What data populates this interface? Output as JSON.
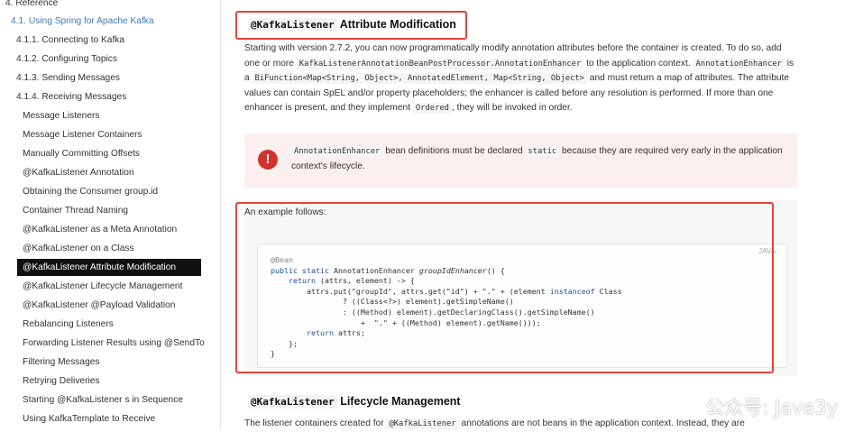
{
  "sidebar": {
    "items": [
      {
        "label": "4. Reference",
        "level": 0
      },
      {
        "label": "4.1. Using Spring for Apache Kafka",
        "level": 1
      },
      {
        "label": "4.1.1. Connecting to Kafka",
        "level": 2
      },
      {
        "label": "4.1.2. Configuring Topics",
        "level": 2
      },
      {
        "label": "4.1.3. Sending Messages",
        "level": 2
      },
      {
        "label": "4.1.4. Receiving Messages",
        "level": 2
      },
      {
        "label": "Message Listeners",
        "level": 3
      },
      {
        "label": "Message Listener Containers",
        "level": 3
      },
      {
        "label": "Manually Committing Offsets",
        "level": 3
      },
      {
        "label": "@KafkaListener Annotation",
        "level": 3
      },
      {
        "label": "Obtaining the Consumer group.id",
        "level": 3
      },
      {
        "label": "Container Thread Naming",
        "level": 3
      },
      {
        "label": "@KafkaListener as a Meta Annotation",
        "level": 3
      },
      {
        "label": "@KafkaListener on a Class",
        "level": 3
      },
      {
        "label": "@KafkaListener Attribute Modification",
        "level": 3,
        "active": true
      },
      {
        "label": "@KafkaListener Lifecycle Management",
        "level": 3
      },
      {
        "label": "@KafkaListener @Payload Validation",
        "level": 3
      },
      {
        "label": "Rebalancing Listeners",
        "level": 3
      },
      {
        "label": "Forwarding Listener Results using @SendTo",
        "level": 3
      },
      {
        "label": "Filtering Messages",
        "level": 3
      },
      {
        "label": "Retrying Deliveries",
        "level": 3
      },
      {
        "label": "Starting @KafkaListener s in Sequence",
        "level": 3
      },
      {
        "label": "Using KafkaTemplate to Receive",
        "level": 3
      }
    ]
  },
  "section1": {
    "title_code": "@KafkaListener",
    "title_text": "Attribute Modification",
    "p1_a": "Starting with version 2.7.2, you can now programmatically modify annotation attributes before the container is created. To do so, add one or more",
    "p1_code1": "KafkaListenerAnnotationBeanPostProcessor.AnnotationEnhancer",
    "p1_b": "to the application context.",
    "p1_code2": "AnnotationEnhancer",
    "p1_c": "is a",
    "p1_code3": "BiFunction<Map<String, Object>, AnnotatedElement, Map<String, Object>",
    "p1_d": "and must return a map of attributes. The attribute values can contain SpEL and/or property placeholders; the enhancer is called before any resolution is performed. If more than one enhancer is present, and they implement",
    "p1_code4": "Ordered",
    "p1_e": ", they will be invoked in order."
  },
  "warning": {
    "icon": "exclamation-icon",
    "code1": "AnnotationEnhancer",
    "text_a": "bean definitions must be declared",
    "code2": "static",
    "text_b": "because they are required very early in the application context's lifecycle."
  },
  "example": {
    "intro": "An example follows:",
    "lang": "JAVA",
    "lines": [
      "@Bean",
      "public static AnnotationEnhancer groupIdEnhancer() {",
      "    return (attrs, element) -> {",
      "        attrs.put(\"groupId\", attrs.get(\"id\") + \".\" + (element instanceof Class",
      "                ? ((Class<?>) element).getSimpleName()",
      "                : ((Method) element).getDeclaringClass().getSimpleName()",
      "                    +  \".\" + ((Method) element).getName()));",
      "        return attrs;",
      "    };",
      "}"
    ]
  },
  "section2": {
    "title_code": "@KafkaListener",
    "title_text": "Lifecycle Management",
    "p_a": "The listener containers created for",
    "p_code": "@KafkaListener",
    "p_b": "annotations are not beans in the application context. Instead, they are"
  },
  "watermark": "公众号: Java3y",
  "colors": {
    "highlight_box": "#e1463a",
    "warning_bg": "#fbefef",
    "warning_icon": "#d2312c",
    "active_nav_bg": "#111111",
    "link": "#3b7ab8"
  }
}
